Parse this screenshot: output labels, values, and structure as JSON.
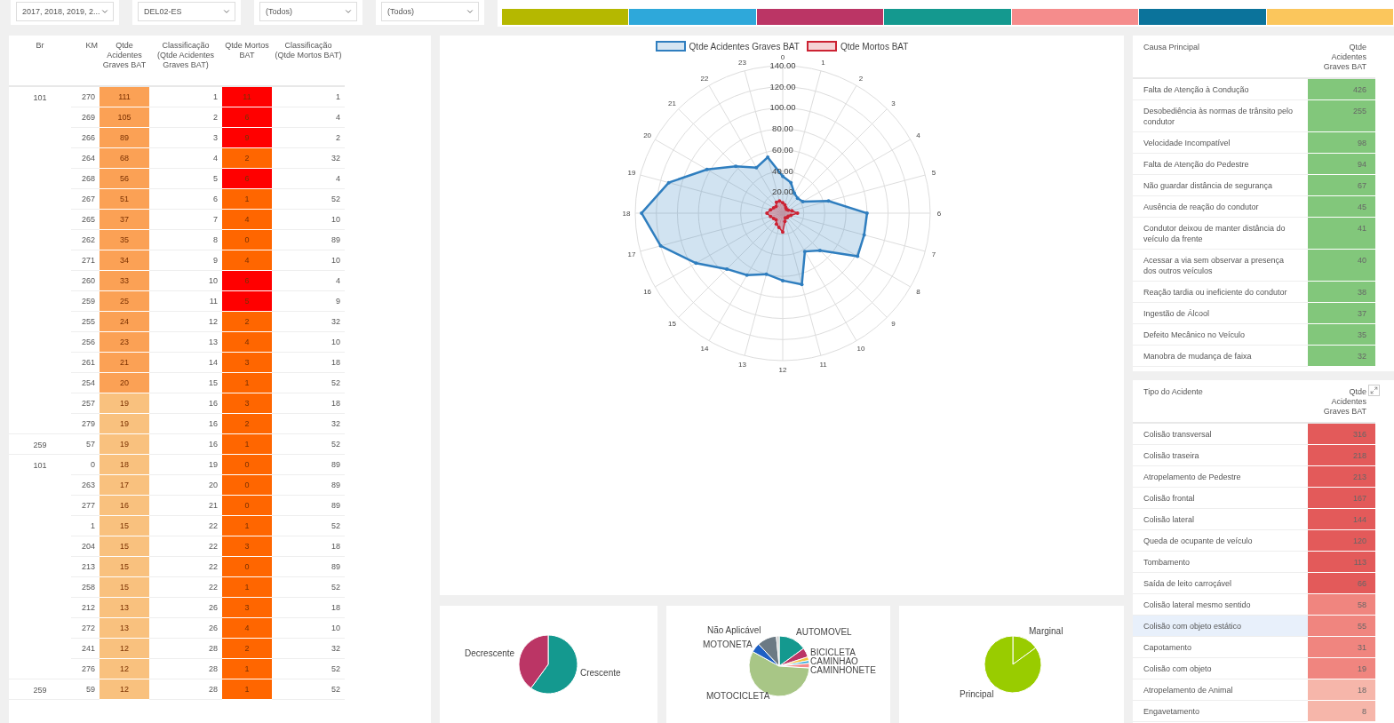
{
  "filters": [
    {
      "value": "2017, 2018, 2019, 2..."
    },
    {
      "value": "DEL02-ES"
    },
    {
      "value": "(Todos)"
    },
    {
      "value": "(Todos)"
    }
  ],
  "color_strip": [
    {
      "color": "#b5b800"
    },
    {
      "color": "#2ea8da"
    },
    {
      "color": "#bb3565"
    },
    {
      "color": "#14998f"
    },
    {
      "color": "#f58c8c"
    },
    {
      "color": "#0b739b"
    },
    {
      "color": "#fbc65c"
    }
  ],
  "km_table": {
    "columns": [
      "Br",
      "KM",
      "Qtde Acidentes Graves BAT",
      "Classificação (Qtde Acidentes Graves BAT)",
      "Qtde Mortos BAT",
      "Classificação (Qtde Mortos BAT)"
    ],
    "groups": [
      {
        "br": "101",
        "rows": [
          {
            "km": "270",
            "accidents": {
              "text": "111",
              "color": "#fba155"
            },
            "rank": "1",
            "deaths": {
              "text": "11",
              "color": "#ff0000"
            },
            "deaths_rank": "1"
          },
          {
            "km": "269",
            "accidents": {
              "text": "105",
              "color": "#fba155"
            },
            "rank": "2",
            "deaths": {
              "text": "6",
              "color": "#ff0000"
            },
            "deaths_rank": "4"
          },
          {
            "km": "266",
            "accidents": {
              "text": "89",
              "color": "#fba155"
            },
            "rank": "3",
            "deaths": {
              "text": "9",
              "color": "#ff0000"
            },
            "deaths_rank": "2"
          },
          {
            "km": "264",
            "accidents": {
              "text": "68",
              "color": "#fba155"
            },
            "rank": "4",
            "deaths": {
              "text": "2",
              "color": "#ff6600"
            },
            "deaths_rank": "32"
          },
          {
            "km": "268",
            "accidents": {
              "text": "56",
              "color": "#fba155"
            },
            "rank": "5",
            "deaths": {
              "text": "6",
              "color": "#ff0000"
            },
            "deaths_rank": "4"
          },
          {
            "km": "267",
            "accidents": {
              "text": "51",
              "color": "#fba155"
            },
            "rank": "6",
            "deaths": {
              "text": "1",
              "color": "#ff6600"
            },
            "deaths_rank": "52"
          },
          {
            "km": "265",
            "accidents": {
              "text": "37",
              "color": "#fba155"
            },
            "rank": "7",
            "deaths": {
              "text": "4",
              "color": "#ff6600"
            },
            "deaths_rank": "10"
          },
          {
            "km": "262",
            "accidents": {
              "text": "35",
              "color": "#fba155"
            },
            "rank": "8",
            "deaths": {
              "text": "0",
              "color": "#ff6600"
            },
            "deaths_rank": "89"
          },
          {
            "km": "271",
            "accidents": {
              "text": "34",
              "color": "#fba155"
            },
            "rank": "9",
            "deaths": {
              "text": "4",
              "color": "#ff6600"
            },
            "deaths_rank": "10"
          },
          {
            "km": "260",
            "accidents": {
              "text": "33",
              "color": "#fba155"
            },
            "rank": "10",
            "deaths": {
              "text": "6",
              "color": "#ff0000"
            },
            "deaths_rank": "4"
          },
          {
            "km": "259",
            "accidents": {
              "text": "25",
              "color": "#fba155"
            },
            "rank": "11",
            "deaths": {
              "text": "5",
              "color": "#ff0000"
            },
            "deaths_rank": "9"
          },
          {
            "km": "255",
            "accidents": {
              "text": "24",
              "color": "#fba155"
            },
            "rank": "12",
            "deaths": {
              "text": "2",
              "color": "#ff6600"
            },
            "deaths_rank": "32"
          },
          {
            "km": "256",
            "accidents": {
              "text": "23",
              "color": "#fba155"
            },
            "rank": "13",
            "deaths": {
              "text": "4",
              "color": "#ff6600"
            },
            "deaths_rank": "10"
          },
          {
            "km": "261",
            "accidents": {
              "text": "21",
              "color": "#fba155"
            },
            "rank": "14",
            "deaths": {
              "text": "3",
              "color": "#ff6600"
            },
            "deaths_rank": "18"
          },
          {
            "km": "254",
            "accidents": {
              "text": "20",
              "color": "#fba155"
            },
            "rank": "15",
            "deaths": {
              "text": "1",
              "color": "#ff6600"
            },
            "deaths_rank": "52"
          },
          {
            "km": "257",
            "accidents": {
              "text": "19",
              "color": "#f9c17e"
            },
            "rank": "16",
            "deaths": {
              "text": "3",
              "color": "#ff6600"
            },
            "deaths_rank": "18"
          },
          {
            "km": "279",
            "accidents": {
              "text": "19",
              "color": "#f9c17e"
            },
            "rank": "16",
            "deaths": {
              "text": "2",
              "color": "#ff6600"
            },
            "deaths_rank": "32"
          }
        ]
      },
      {
        "br": "259",
        "rows": [
          {
            "km": "57",
            "accidents": {
              "text": "19",
              "color": "#f9c17e"
            },
            "rank": "16",
            "deaths": {
              "text": "1",
              "color": "#ff6600"
            },
            "deaths_rank": "52"
          }
        ]
      },
      {
        "br": "101",
        "rows": [
          {
            "km": "0",
            "accidents": {
              "text": "18",
              "color": "#f9c17e"
            },
            "rank": "19",
            "deaths": {
              "text": "0",
              "color": "#ff6600"
            },
            "deaths_rank": "89"
          },
          {
            "km": "263",
            "accidents": {
              "text": "17",
              "color": "#f9c17e"
            },
            "rank": "20",
            "deaths": {
              "text": "0",
              "color": "#ff6600"
            },
            "deaths_rank": "89"
          },
          {
            "km": "277",
            "accidents": {
              "text": "16",
              "color": "#f9c17e"
            },
            "rank": "21",
            "deaths": {
              "text": "0",
              "color": "#ff6600"
            },
            "deaths_rank": "89"
          },
          {
            "km": "1",
            "accidents": {
              "text": "15",
              "color": "#f9c17e"
            },
            "rank": "22",
            "deaths": {
              "text": "1",
              "color": "#ff6600"
            },
            "deaths_rank": "52"
          },
          {
            "km": "204",
            "accidents": {
              "text": "15",
              "color": "#f9c17e"
            },
            "rank": "22",
            "deaths": {
              "text": "3",
              "color": "#ff6600"
            },
            "deaths_rank": "18"
          },
          {
            "km": "213",
            "accidents": {
              "text": "15",
              "color": "#f9c17e"
            },
            "rank": "22",
            "deaths": {
              "text": "0",
              "color": "#ff6600"
            },
            "deaths_rank": "89"
          },
          {
            "km": "258",
            "accidents": {
              "text": "15",
              "color": "#f9c17e"
            },
            "rank": "22",
            "deaths": {
              "text": "1",
              "color": "#ff6600"
            },
            "deaths_rank": "52"
          },
          {
            "km": "212",
            "accidents": {
              "text": "13",
              "color": "#f9c17e"
            },
            "rank": "26",
            "deaths": {
              "text": "3",
              "color": "#ff6600"
            },
            "deaths_rank": "18"
          },
          {
            "km": "272",
            "accidents": {
              "text": "13",
              "color": "#f9c17e"
            },
            "rank": "26",
            "deaths": {
              "text": "4",
              "color": "#ff6600"
            },
            "deaths_rank": "10"
          },
          {
            "km": "241",
            "accidents": {
              "text": "12",
              "color": "#f9c17e"
            },
            "rank": "28",
            "deaths": {
              "text": "2",
              "color": "#ff6600"
            },
            "deaths_rank": "32"
          },
          {
            "km": "276",
            "accidents": {
              "text": "12",
              "color": "#f9c17e"
            },
            "rank": "28",
            "deaths": {
              "text": "1",
              "color": "#ff6600"
            },
            "deaths_rank": "52"
          }
        ]
      },
      {
        "br": "259",
        "rows": [
          {
            "km": "59",
            "accidents": {
              "text": "12",
              "color": "#f9c17e"
            },
            "rank": "28",
            "deaths": {
              "text": "1",
              "color": "#ff6600"
            },
            "deaths_rank": "52"
          }
        ]
      }
    ]
  },
  "radar": {
    "legend": [
      {
        "name": "Qtde Acidentes Graves BAT",
        "color": "#2f7ebf"
      },
      {
        "name": "Qtde Mortos BAT",
        "color": "#cc2233"
      }
    ],
    "axis_labels": [
      "0",
      "1",
      "2",
      "3",
      "4",
      "5",
      "6",
      "7",
      "8",
      "9",
      "10",
      "11",
      "12",
      "13",
      "14",
      "15",
      "16",
      "17",
      "18",
      "19",
      "20",
      "21",
      "22",
      "23"
    ],
    "tick_labels": [
      "140.00",
      "120.00",
      "100.00",
      "80.00",
      "60.00",
      "40.00",
      "20.00"
    ]
  },
  "pies": [
    {
      "labels": [
        "Decrescente",
        "Crescente"
      ]
    },
    {
      "labels": [
        "Não Aplicável",
        "AUTOMOVEL",
        "MOTONETA",
        "BICICLETA",
        "CAMINHAO",
        "CAMINHONETE",
        "MOTOCICLETA"
      ]
    },
    {
      "labels": [
        "Marginal",
        "Principal"
      ]
    }
  ],
  "cause_table": {
    "columns": [
      "Causa Principal",
      "Qtde Acidentes Graves BAT"
    ],
    "rows": [
      {
        "label": "Falta de Atenção à Condução",
        "value": "426"
      },
      {
        "label": "Desobediência às normas de trânsito pelo condutor",
        "value": "255"
      },
      {
        "label": "Velocidade Incompatível",
        "value": "98"
      },
      {
        "label": "Falta de Atenção do Pedestre",
        "value": "94"
      },
      {
        "label": "Não guardar distância de segurança",
        "value": "67"
      },
      {
        "label": "Ausência de reação do condutor",
        "value": "45"
      },
      {
        "label": "Condutor deixou de manter distância do veículo da frente",
        "value": "41"
      },
      {
        "label": "Acessar a via sem observar a presença dos outros veículos",
        "value": "40"
      },
      {
        "label": "Reação tardia ou ineficiente do condutor",
        "value": "38"
      },
      {
        "label": "Ingestão de Álcool",
        "value": "37"
      },
      {
        "label": "Defeito Mecânico no Veículo",
        "value": "35"
      },
      {
        "label": "Manobra de mudança de faixa",
        "value": "32"
      }
    ]
  },
  "type_table": {
    "columns": [
      "Tipo do Acidente",
      "Qtde Acidentes Graves BAT"
    ],
    "rows": [
      {
        "label": "Colisão transversal",
        "value": "316",
        "color": "#e35a5a",
        "selected": false
      },
      {
        "label": "Colisão traseira",
        "value": "218",
        "color": "#e35a5a",
        "selected": false
      },
      {
        "label": "Atropelamento de Pedestre",
        "value": "213",
        "color": "#e35a5a",
        "selected": false
      },
      {
        "label": "Colisão frontal",
        "value": "167",
        "color": "#e35a5a",
        "selected": false
      },
      {
        "label": "Colisão lateral",
        "value": "144",
        "color": "#e35a5a",
        "selected": false
      },
      {
        "label": "Queda de ocupante de veículo",
        "value": "120",
        "color": "#e35a5a",
        "selected": false
      },
      {
        "label": "Tombamento",
        "value": "113",
        "color": "#e35a5a",
        "selected": false
      },
      {
        "label": "Saída de leito carroçável",
        "value": "66",
        "color": "#e35a5a",
        "selected": false
      },
      {
        "label": "Colisão lateral mesmo sentido",
        "value": "58",
        "color": "#f0857f",
        "selected": false
      },
      {
        "label": "Colisão com objeto estático",
        "value": "55",
        "color": "#f0857f",
        "selected": true
      },
      {
        "label": "Capotamento",
        "value": "31",
        "color": "#f0857f",
        "selected": false
      },
      {
        "label": "Colisão com objeto",
        "value": "19",
        "color": "#f0857f",
        "selected": false
      },
      {
        "label": "Atropelamento de Animal",
        "value": "18",
        "color": "#f6b6aa",
        "selected": false
      },
      {
        "label": "Engavetamento",
        "value": "8",
        "color": "#f6b6aa",
        "selected": false
      }
    ]
  }
}
